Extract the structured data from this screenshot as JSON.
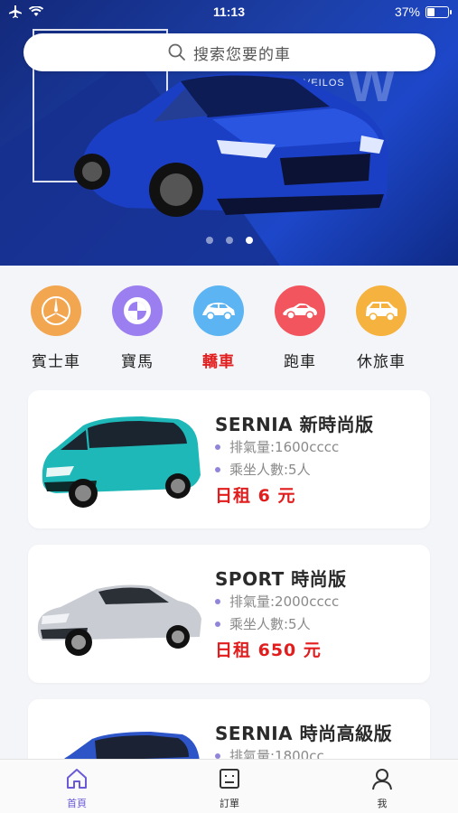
{
  "status_bar": {
    "time": "11:13",
    "battery": "37%",
    "battery_level": 0.37
  },
  "search": {
    "placeholder": "搜索您要的車",
    "icon": "search-icon"
  },
  "banner": {
    "brand_text": "VEILOS",
    "deco_text": "W",
    "dots": 3,
    "active_dot": 2
  },
  "categories": [
    {
      "label": "賓士車",
      "icon": "mercedes-logo-icon",
      "color": "#f2a650",
      "active": false
    },
    {
      "label": "寶馬",
      "icon": "bmw-logo-icon",
      "color": "#9b7ff0",
      "active": false
    },
    {
      "label": "轎車",
      "icon": "sedan-icon",
      "color": "#5cb4f2",
      "active": true
    },
    {
      "label": "跑車",
      "icon": "sports-car-icon",
      "color": "#f2555e",
      "active": false
    },
    {
      "label": "休旅車",
      "icon": "suv-icon",
      "color": "#f5b23e",
      "active": false
    }
  ],
  "cars": [
    {
      "name": "SERNIA 新時尚版",
      "displacement": "排氣量:1600cccc",
      "seats": "乘坐人數:5人",
      "price": "日租 6 元",
      "color": "#1fb8b8"
    },
    {
      "name": "SPORT 時尚版",
      "displacement": "排氣量:2000cccc",
      "seats": "乘坐人數:5人",
      "price": "日租 650 元",
      "color": "#c9ccd2"
    },
    {
      "name": "SERNIA 時尚高級版",
      "displacement": "排氣量:1800cc",
      "seats": "",
      "price": "",
      "color": "#2d55c8"
    }
  ],
  "tab_bar": [
    {
      "label": "首頁",
      "icon": "home-icon",
      "active": true
    },
    {
      "label": "訂單",
      "icon": "order-icon",
      "active": false
    },
    {
      "label": "我",
      "icon": "user-icon",
      "active": false
    }
  ],
  "colors": {
    "accent": "#6a5ad8",
    "price_red": "#e11d1d",
    "spec_bullet": "#8f86d9"
  }
}
